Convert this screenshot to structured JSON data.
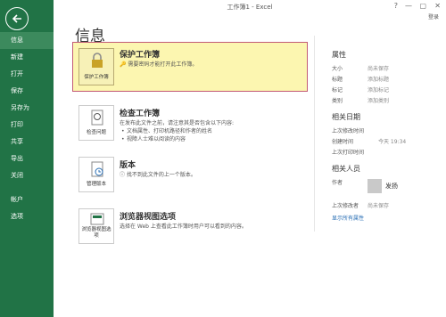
{
  "window": {
    "title": "工作簿1 - Excel",
    "controls": [
      "?",
      "—",
      "▢",
      "✕"
    ],
    "user": "登录"
  },
  "sidebar": {
    "items": [
      {
        "label": "信息",
        "active": true
      },
      {
        "label": "新建"
      },
      {
        "label": "打开"
      },
      {
        "label": "保存"
      },
      {
        "label": "另存为"
      },
      {
        "label": "打印"
      },
      {
        "label": "共享"
      },
      {
        "label": "导出"
      },
      {
        "label": "关闭"
      },
      {
        "label": "帐户"
      },
      {
        "label": "选项"
      }
    ]
  },
  "main": {
    "title": "信息",
    "protect": {
      "icon_label": "保护工作簿",
      "title": "保护工作簿",
      "desc": "需要密码才能打开此工作簿。"
    },
    "inspect": {
      "icon_label": "检查问题",
      "title": "检查工作簿",
      "desc": "在发布此文件之前，请注意其是否包含以下内容:",
      "bullets": [
        "文档属性、打印机路径和作者的姓名",
        "视障人士难以阅读的内容"
      ]
    },
    "versions": {
      "icon_label": "管理版本",
      "title": "版本",
      "desc": "找不到此文件的上一个版本。"
    },
    "browser": {
      "icon_label": "浏览器视图选项",
      "title": "浏览器视图选项",
      "desc": "选择在 Web 上查看此工作簿时用户可以看到的内容。"
    }
  },
  "properties": {
    "header": "属性",
    "rows": [
      {
        "k": "大小",
        "v": "尚未保存"
      },
      {
        "k": "标题",
        "v": "添加标题"
      },
      {
        "k": "标记",
        "v": "添加标记"
      },
      {
        "k": "类别",
        "v": "添加类别"
      }
    ],
    "dates_header": "相关日期",
    "dates": [
      {
        "k": "上次修改时间",
        "v": ""
      },
      {
        "k": "创建时间",
        "v": "今天 19:34"
      },
      {
        "k": "上次打印时间",
        "v": ""
      }
    ],
    "people_header": "相关人员",
    "author_label": "作者",
    "author_name": "发扬",
    "last_modified_by_label": "上次修改者",
    "last_modified_by_value": "尚未保存",
    "show_all": "显示所有属性"
  },
  "colors": {
    "sidebar": "#217346",
    "highlight": "#fcf6b0",
    "highlight_border": "#c25a76"
  }
}
